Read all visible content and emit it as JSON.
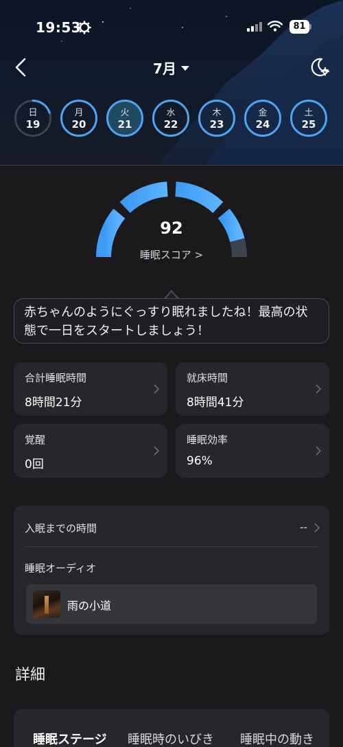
{
  "status_bar": {
    "time": "19:53",
    "battery": "81"
  },
  "header": {
    "month": "7月"
  },
  "days": [
    {
      "name": "日",
      "date": "19",
      "progress": 0.2,
      "selected": false
    },
    {
      "name": "月",
      "date": "20",
      "progress": 1,
      "selected": false
    },
    {
      "name": "火",
      "date": "21",
      "progress": 1,
      "selected": true
    },
    {
      "name": "水",
      "date": "22",
      "progress": 1,
      "selected": false
    },
    {
      "name": "木",
      "date": "23",
      "progress": 1,
      "selected": false
    },
    {
      "name": "金",
      "date": "24",
      "progress": 1,
      "selected": false
    },
    {
      "name": "土",
      "date": "25",
      "progress": 1,
      "selected": false
    }
  ],
  "score": {
    "value": "92",
    "label": "睡眠スコア >",
    "max": 100
  },
  "message": "赤ちゃんのようにぐっすり眠れましたね！最高の状態で一日をスタートしましょう！",
  "metrics": [
    {
      "title": "合計睡眠時間",
      "value": "8時間21分"
    },
    {
      "title": "就床時間",
      "value": "8時間41分"
    },
    {
      "title": "覚醒",
      "value": "0回"
    },
    {
      "title": "睡眠効率",
      "value": "96%"
    }
  ],
  "sleep_onset": {
    "label": "入眠までの時間",
    "value": "--"
  },
  "sleep_audio": {
    "label": "睡眠オーディオ",
    "track": "雨の小道"
  },
  "details": {
    "title": "詳細",
    "tabs": [
      "睡眠ステージ",
      "睡眠時のいびき",
      "睡眠中の動き"
    ]
  },
  "colors": {
    "accent": "#4aa6f5",
    "accent_light": "#67b8ff",
    "ring_track": "#3d4350",
    "card_bg": "#26272b",
    "page_bg": "#1a1a1c"
  }
}
